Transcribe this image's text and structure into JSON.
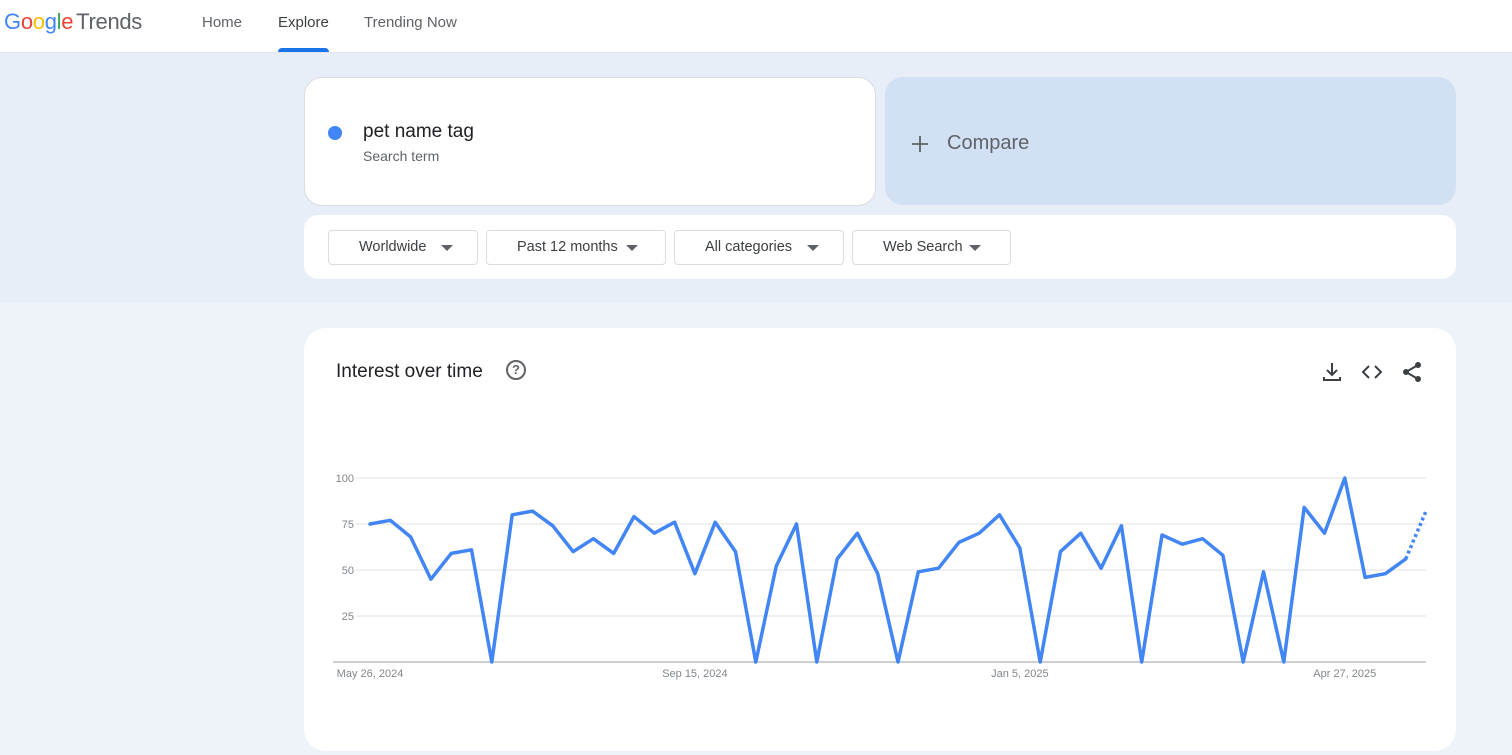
{
  "header": {
    "logo_google": "Google",
    "logo_trends": "Trends",
    "nav": [
      {
        "label": "Home"
      },
      {
        "label": "Explore",
        "active": true
      },
      {
        "label": "Trending Now"
      }
    ]
  },
  "search": {
    "term": "pet name tag",
    "term_sub": "Search term",
    "term_color": "#4285f4",
    "compare_label": "Compare"
  },
  "filters": [
    {
      "label": "Worldwide"
    },
    {
      "label": "Past 12 months"
    },
    {
      "label": "All categories"
    },
    {
      "label": "Web Search"
    }
  ],
  "interest": {
    "title": "Interest over time",
    "icons": [
      "help-icon",
      "download-icon",
      "embed-icon",
      "share-icon"
    ]
  },
  "chart_data": {
    "type": "line",
    "title": "",
    "xlabel": "",
    "ylabel": "",
    "ylim": [
      0,
      100
    ],
    "yticks": [
      25,
      50,
      75,
      100
    ],
    "x_tick_labels": [
      "May 26, 2024",
      "Sep 15, 2024",
      "Jan 5, 2025",
      "Apr 27, 2025"
    ],
    "x_tick_indices": [
      0,
      16,
      32,
      48
    ],
    "grid": true,
    "series": [
      {
        "color": "#4285f4",
        "partial_from_index": 51,
        "values": [
          75,
          77,
          68,
          45,
          59,
          61,
          0,
          80,
          82,
          74,
          60,
          67,
          59,
          79,
          70,
          76,
          48,
          76,
          60,
          0,
          52,
          75,
          0,
          56,
          70,
          48,
          0,
          49,
          51,
          65,
          70,
          80,
          62,
          0,
          60,
          70,
          51,
          74,
          0,
          69,
          64,
          67,
          58,
          0,
          49,
          0,
          84,
          70,
          100,
          46,
          48,
          56,
          82
        ]
      }
    ]
  }
}
